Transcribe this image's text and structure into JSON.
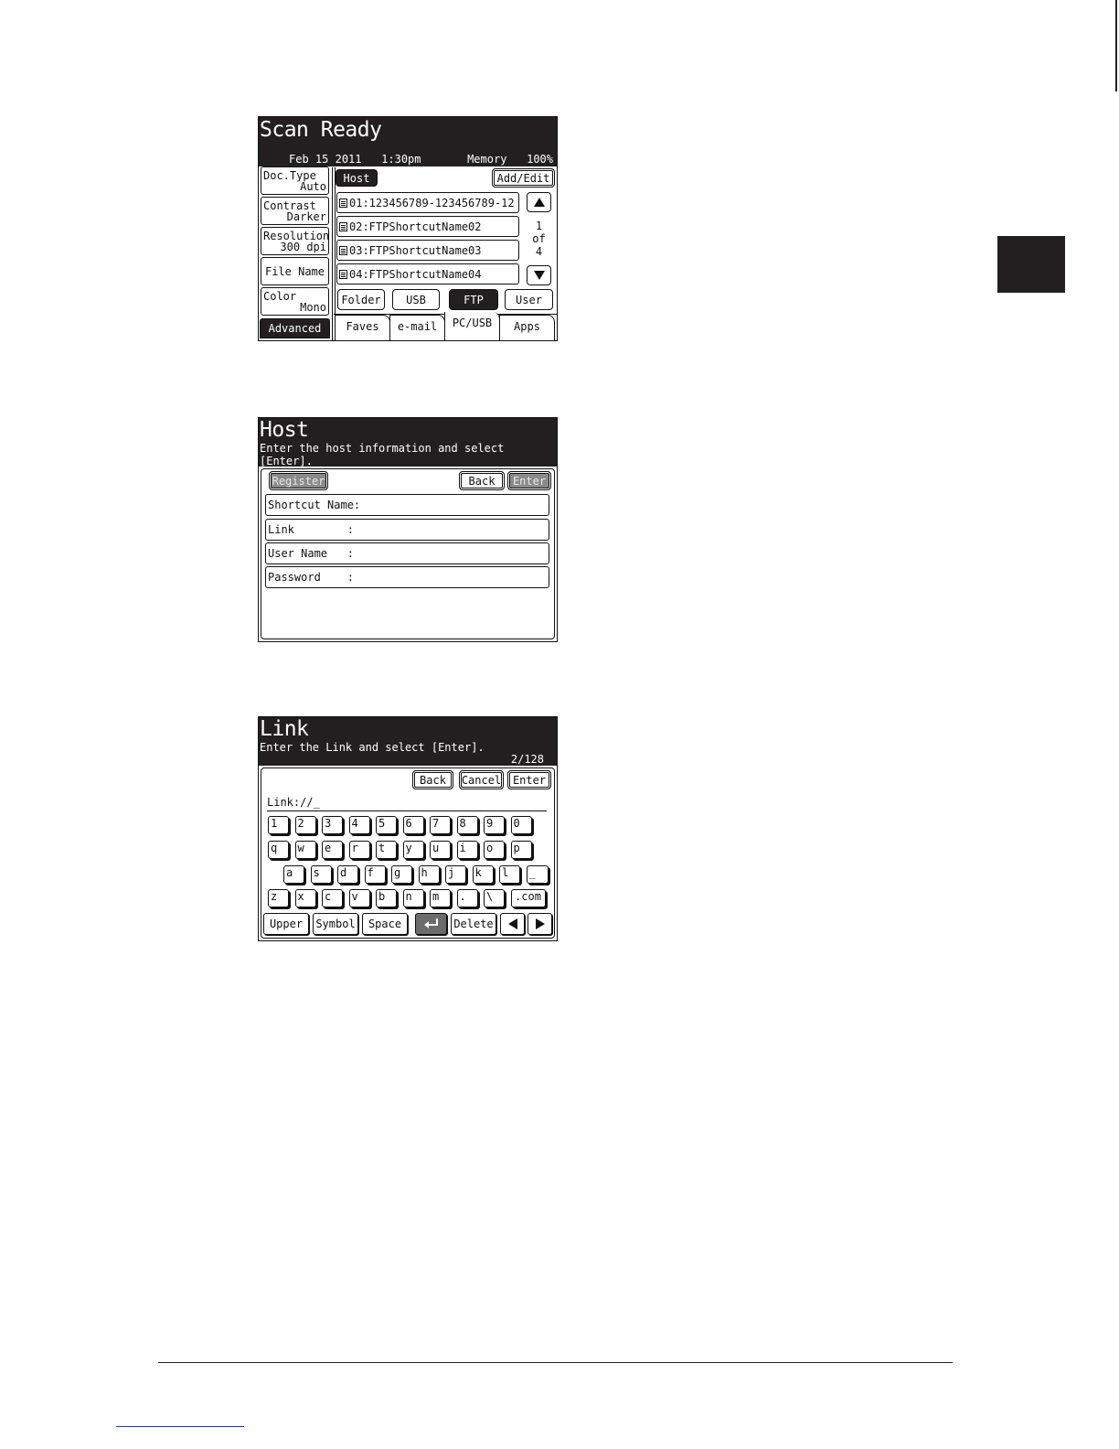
{
  "screen1": {
    "title": "Scan Ready",
    "status": "Feb 15 2011   1:30pm       Memory   100%",
    "left": [
      {
        "a": "Doc.Type",
        "b": "Auto"
      },
      {
        "a": "Contrast",
        "b": "Darker"
      },
      {
        "a": "Resolution",
        "b": "300 dpi"
      },
      {
        "a": "File Name",
        "b": ""
      },
      {
        "a": "Color",
        "b": "Mono"
      }
    ],
    "advanced": "Advanced",
    "host": "Host",
    "add_edit": "Add/Edit",
    "list": [
      "01:123456789-123456789-12",
      "02:FTPShortcutName02",
      "03:FTPShortcutName03",
      "04:FTPShortcutName04"
    ],
    "page_cur": "1",
    "page_of": "of",
    "page_total": "4",
    "dest_tabs": [
      "Folder",
      "USB",
      "FTP",
      "User"
    ],
    "selected_dest": "FTP",
    "tabs": [
      "Faves",
      "e-mail",
      "PC/USB",
      "Apps"
    ],
    "selected_tab": "PC/USB"
  },
  "screen2": {
    "title": "Host",
    "subtitle": "Enter the host information and select\n[Enter].",
    "register": "Register",
    "back": "Back",
    "enter": "Enter",
    "fields": [
      "Shortcut Name:",
      "Link        :",
      "User Name   :",
      "Password    :"
    ]
  },
  "screen3": {
    "title": "Link",
    "subtitle": "Enter the Link and select [Enter].",
    "counter": "2/128",
    "back": "Back",
    "cancel": "Cancel",
    "enter": "Enter",
    "input": "Link://_",
    "rows": [
      [
        "1",
        "2",
        "3",
        "4",
        "5",
        "6",
        "7",
        "8",
        "9",
        "0"
      ],
      [
        "q",
        "w",
        "e",
        "r",
        "t",
        "y",
        "u",
        "i",
        "o",
        "p"
      ],
      [
        "a",
        "s",
        "d",
        "f",
        "g",
        "h",
        "j",
        "k",
        "l",
        "_"
      ],
      [
        "z",
        "x",
        "c",
        "v",
        "b",
        "n",
        "m",
        ".",
        "\\",
        ".com"
      ]
    ],
    "funcs": {
      "upper": "Upper",
      "symbol": "Symbol",
      "space": "Space",
      "return_icon": "return-arrow-icon",
      "delete": "Delete"
    }
  },
  "colors": {
    "header": "#231f20",
    "disabled": "#8a8a8a",
    "side_tab": "#231f20"
  }
}
